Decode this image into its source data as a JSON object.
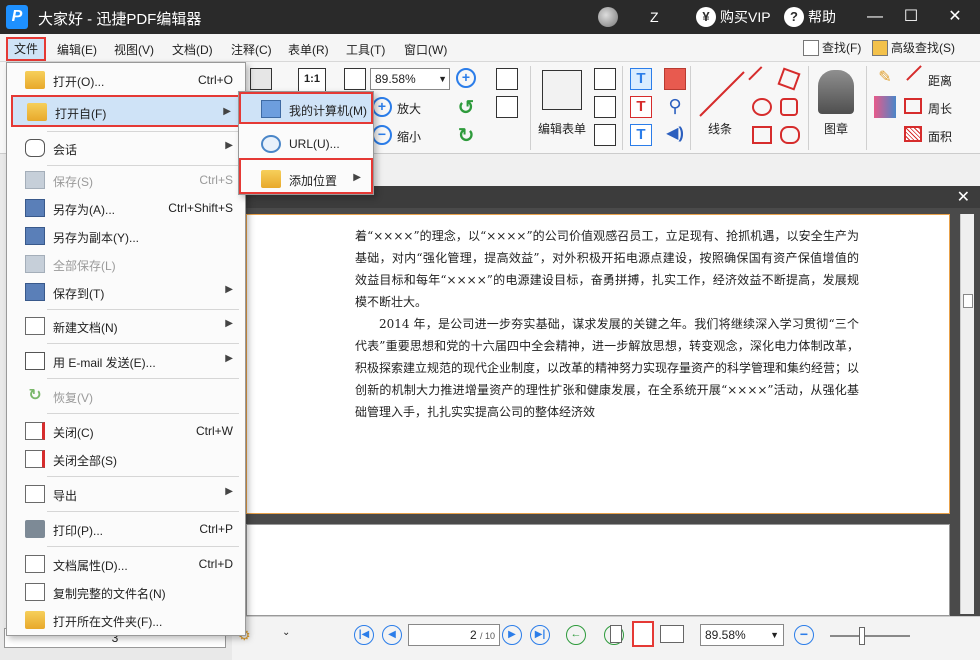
{
  "window": {
    "app_title": "大家好 - 迅捷PDF编辑器",
    "logo_letter": "P",
    "user_name": "Z",
    "buy_vip": "购买VIP",
    "help": "帮助",
    "vip_glyph": "¥",
    "help_glyph": "?",
    "minimize_glyph": "—",
    "maximize_glyph": "☐",
    "close_glyph": "✕"
  },
  "menubar": {
    "items": [
      "文件",
      "编辑(E)",
      "视图(V)",
      "文档(D)",
      "注释(C)",
      "表单(R)",
      "工具(T)",
      "窗口(W)"
    ],
    "find": "查找(F)",
    "advanced_find": "高级查找(S)"
  },
  "toolbar": {
    "zoom_value": "89.58%",
    "zoom_in": "放大",
    "zoom_out": "缩小",
    "edit_form": "编辑表单",
    "line": "线条",
    "stamp": "图章",
    "distance": "距离",
    "perimeter": "周长",
    "area": "面积",
    "actual_size_glyph": "1:1"
  },
  "file_menu": {
    "items": [
      {
        "label": "打开(O)...",
        "shortcut": "Ctrl+O",
        "submenu": false,
        "disabled": false,
        "icon": "folder-open-icon"
      },
      {
        "label": "打开自(F)",
        "shortcut": "",
        "submenu": true,
        "disabled": false,
        "icon": "folder-globe-icon",
        "highlight": true
      },
      {
        "label": "会话",
        "shortcut": "",
        "submenu": true,
        "disabled": false,
        "icon": "session-icon"
      },
      {
        "label": "保存(S)",
        "shortcut": "Ctrl+S",
        "submenu": false,
        "disabled": true,
        "icon": "save-icon"
      },
      {
        "label": "另存为(A)...",
        "shortcut": "Ctrl+Shift+S",
        "submenu": false,
        "disabled": false,
        "icon": "save-as-icon"
      },
      {
        "label": "另存为副本(Y)...",
        "shortcut": "",
        "submenu": false,
        "disabled": false,
        "icon": "save-copy-icon"
      },
      {
        "label": "全部保存(L)",
        "shortcut": "",
        "submenu": false,
        "disabled": true,
        "icon": "save-all-icon"
      },
      {
        "label": "保存到(T)",
        "shortcut": "",
        "submenu": true,
        "disabled": false,
        "icon": "save-to-icon"
      },
      {
        "label": "新建文档(N)",
        "shortcut": "",
        "submenu": true,
        "disabled": false,
        "icon": "new-document-icon"
      },
      {
        "label": "用 E-mail 发送(E)...",
        "shortcut": "",
        "submenu": true,
        "disabled": false,
        "icon": "email-icon"
      },
      {
        "label": "恢复(V)",
        "shortcut": "",
        "submenu": false,
        "disabled": true,
        "icon": "revert-icon"
      },
      {
        "label": "关闭(C)",
        "shortcut": "Ctrl+W",
        "submenu": false,
        "disabled": false,
        "icon": "close-document-icon"
      },
      {
        "label": "关闭全部(S)",
        "shortcut": "",
        "submenu": false,
        "disabled": false,
        "icon": "close-all-icon"
      },
      {
        "label": "导出",
        "shortcut": "",
        "submenu": true,
        "disabled": false,
        "icon": "export-icon"
      },
      {
        "label": "打印(P)...",
        "shortcut": "Ctrl+P",
        "submenu": false,
        "disabled": false,
        "icon": "printer-icon"
      },
      {
        "label": "文档属性(D)...",
        "shortcut": "Ctrl+D",
        "submenu": false,
        "disabled": false,
        "icon": "document-properties-icon"
      },
      {
        "label": "复制完整的文件名(N)",
        "shortcut": "",
        "submenu": false,
        "disabled": false,
        "icon": "copy-filename-icon"
      },
      {
        "label": "打开所在文件夹(F)...",
        "shortcut": "",
        "submenu": false,
        "disabled": false,
        "icon": "open-folder-icon"
      }
    ]
  },
  "submenu_open_from": {
    "items": [
      {
        "label": "我的计算机(M)",
        "submenu": false,
        "icon": "my-computer-icon"
      },
      {
        "label": "URL(U)...",
        "submenu": false,
        "icon": "url-globe-icon"
      },
      {
        "label": "添加位置",
        "submenu": true,
        "icon": "add-location-icon"
      }
    ]
  },
  "document": {
    "paragraphs": [
      "着“××××”的理念，以“××××”的公司价值观感召员工，立足现有、抢抓机遇，以安全生产为基础，对内“强化管理，提高效益”，对外积极开拓电源点建设，按照确保国有资产保值增值的效益目标和每年“××××”的电源建设目标，奋勇拼搏，扎实工作，经济效益不断提高，发展规模不断壮大。",
      "2014 年，是公司进一步夯实基础，谋求发展的关键之年。我们将继续深入学习贯彻“三个代表”重要思想和党的十六届四中全会精神，进一步解放思想，转变观念，深化电力体制改革，积极探索建立规范的现代企业制度，以改革的精神努力实现存量资产的科学管理和集约经营；以创新的机制大力推进增量资产的理性扩张和健康发展，在全系统开展“××××”活动，从强化基础管理入手，扎扎实实提高公司的整体经济效"
    ]
  },
  "statusbar": {
    "current_page": "2",
    "page_total": "/ 10",
    "zoom_value": "89.58%",
    "zoom_level_fraction": 0.4
  },
  "left_pane": {
    "page_field": "3"
  },
  "colors": {
    "highlight_border": "#e53935",
    "selection_bg": "#cfe3f7",
    "accent_blue": "#2b7de9",
    "titlebar_bg": "#2a2a2a"
  }
}
